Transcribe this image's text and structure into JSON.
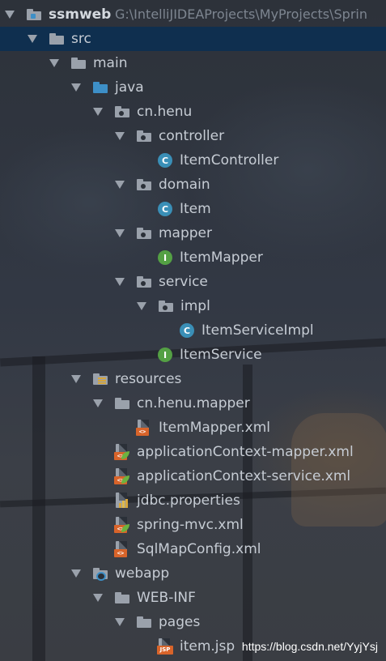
{
  "project": {
    "name": "ssmweb",
    "path": "G:\\IntelliJIDEAProjects\\MyProjects\\Sprin"
  },
  "tree": {
    "src": "src",
    "main": "main",
    "java": "java",
    "package": "cn.henu",
    "controller": "controller",
    "item_controller": "ItemController",
    "domain": "domain",
    "item": "Item",
    "mapper": "mapper",
    "item_mapper": "ItemMapper",
    "service": "service",
    "impl": "impl",
    "item_service_impl": "ItemServiceImpl",
    "item_service": "ItemService",
    "resources": "resources",
    "res_package": "cn.henu.mapper",
    "item_mapper_xml": "ItemMapper.xml",
    "app_ctx_mapper": "applicationContext-mapper.xml",
    "app_ctx_service": "applicationContext-service.xml",
    "jdbc_props": "jdbc.properties",
    "spring_mvc": "spring-mvc.xml",
    "sqlmap_config": "SqlMapConfig.xml",
    "webapp": "webapp",
    "web_inf": "WEB-INF",
    "pages": "pages",
    "item_jsp": "item.jsp"
  },
  "icon_labels": {
    "class": "C",
    "interface": "I",
    "xml_tag": "<>",
    "jsp": "JSP"
  },
  "watermark": "https://blog.csdn.net/YyjYsj",
  "colors": {
    "selection": "#0f2f4f",
    "class_icon": "#3a8fb7",
    "interface_icon": "#54a044",
    "source_folder": "#3d8fc7",
    "xml_badge": "#d8642a"
  }
}
